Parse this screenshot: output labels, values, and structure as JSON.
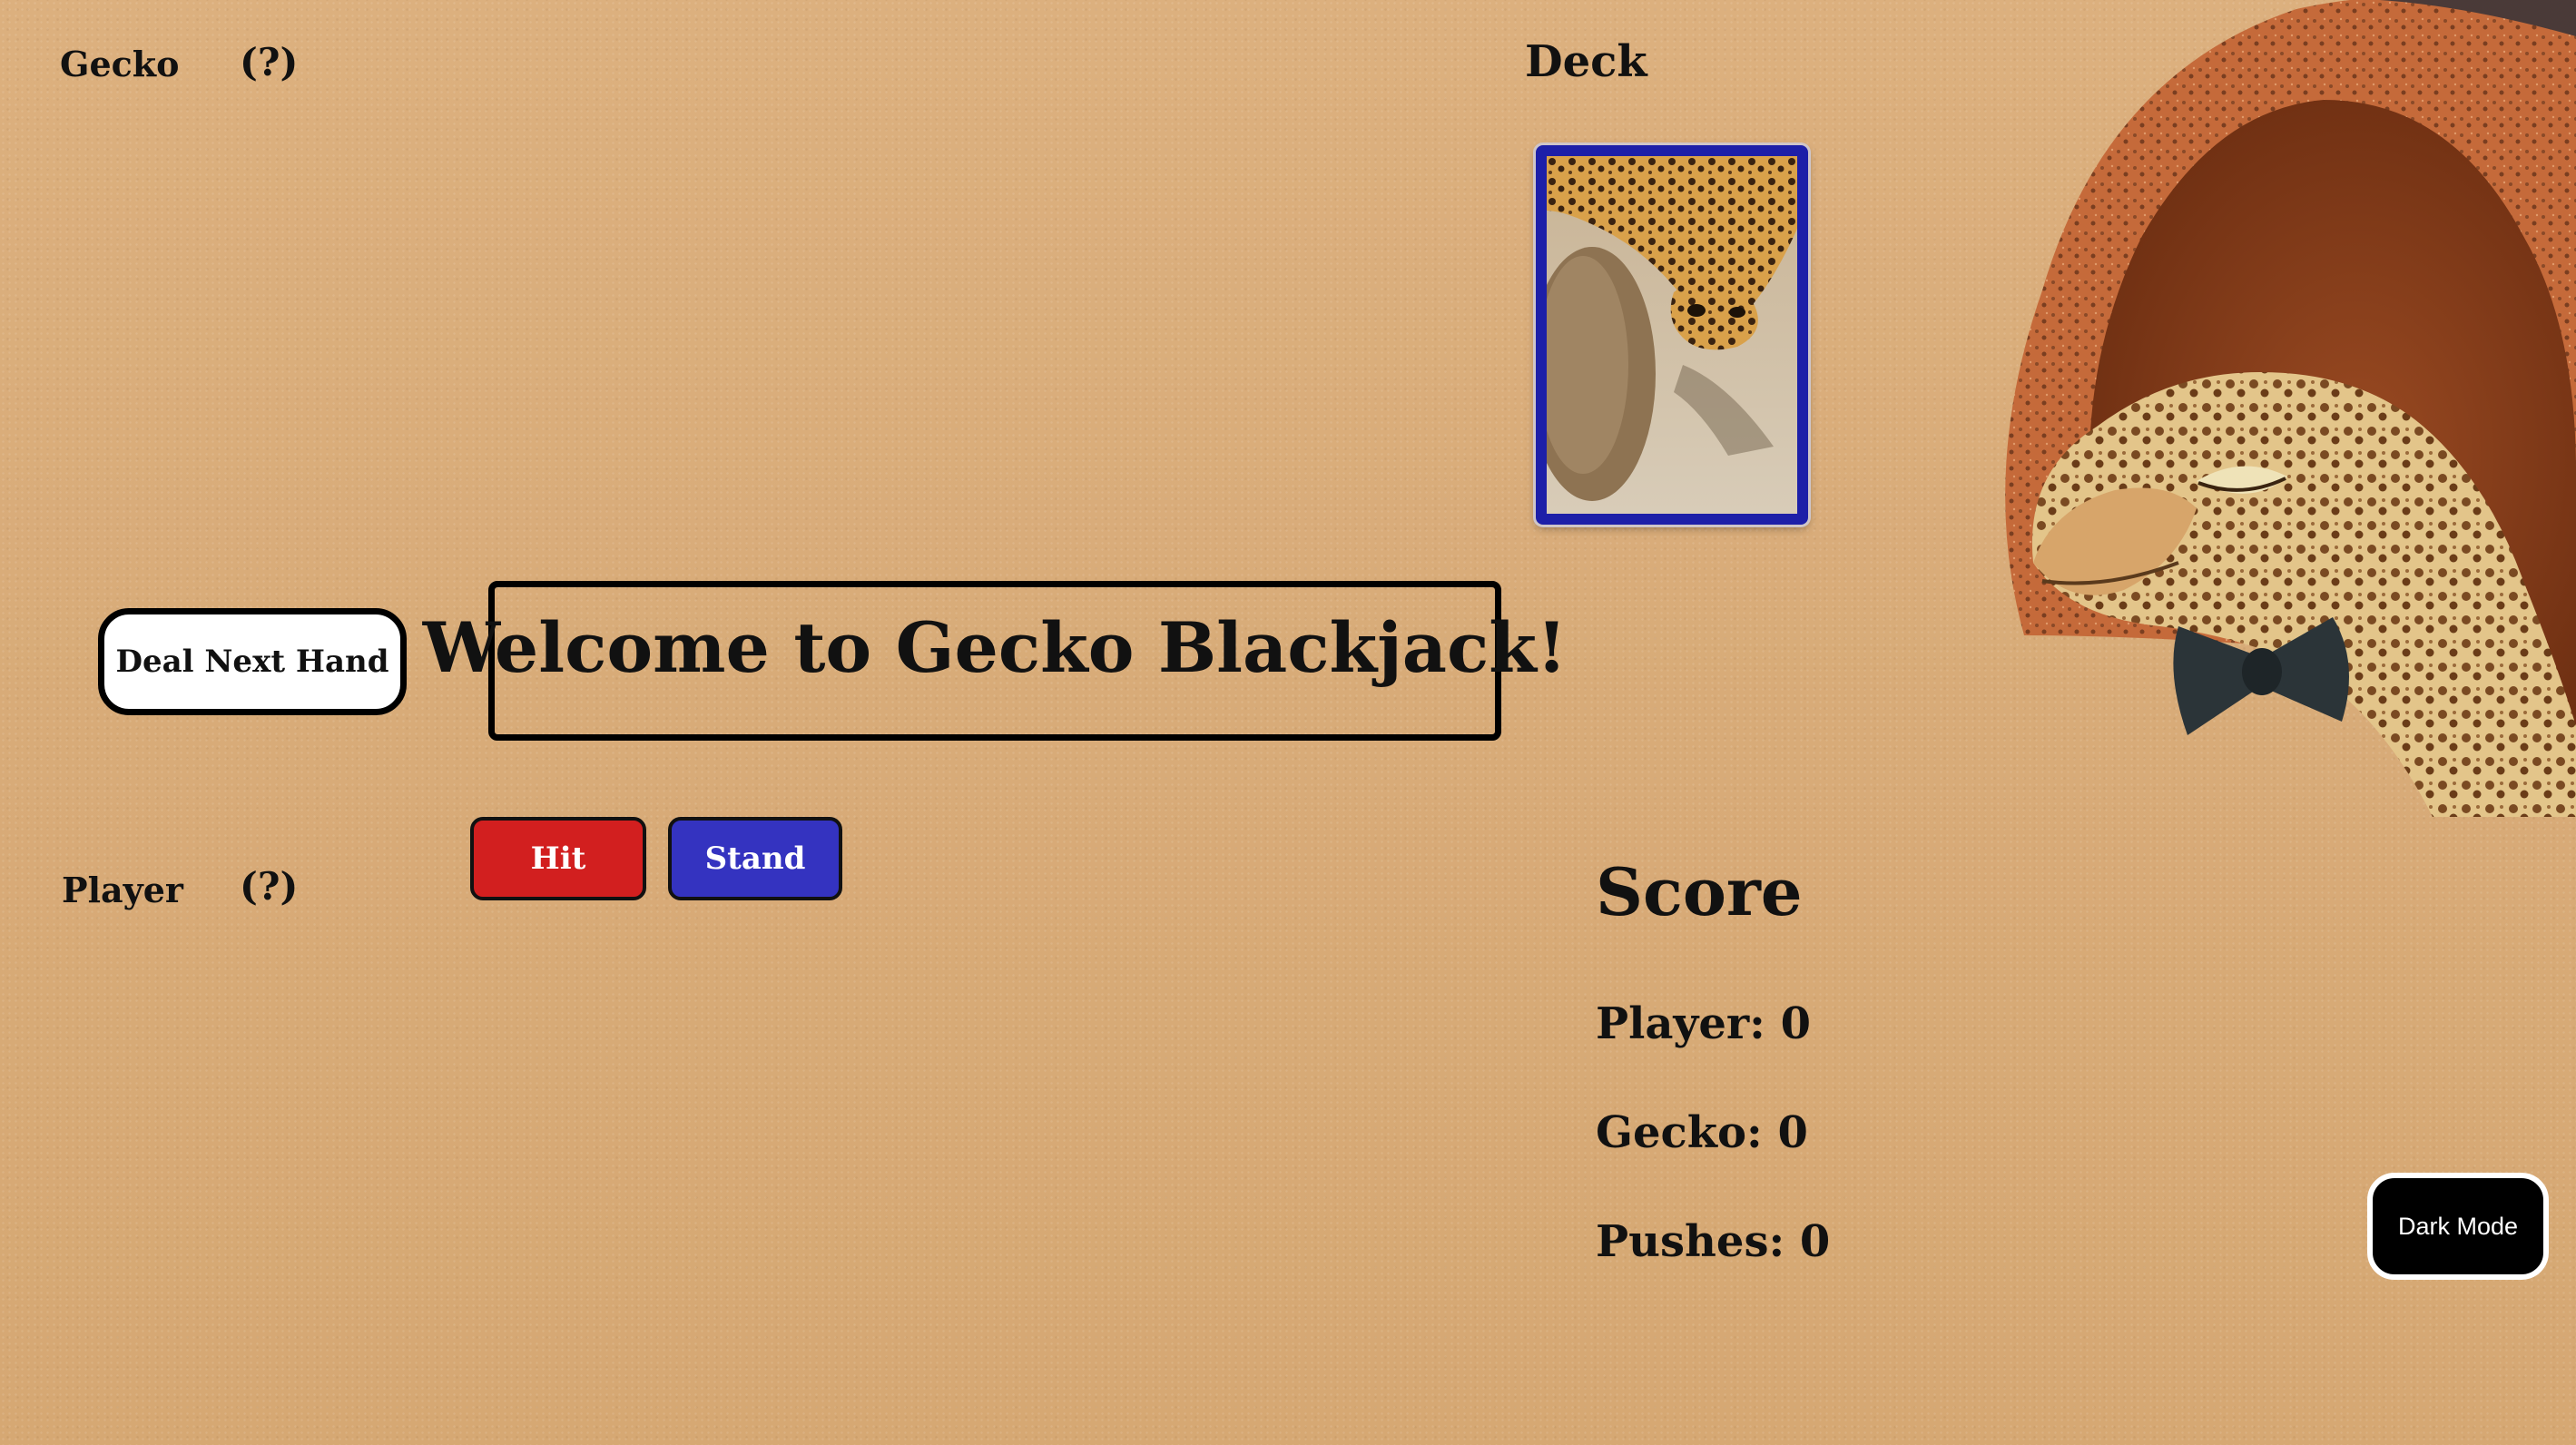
{
  "dealer": {
    "label": "Gecko",
    "total": "(?)"
  },
  "player": {
    "label": "Player",
    "total": "(?)"
  },
  "deck": {
    "label": "Deck",
    "card_back": "gecko-photo-card-back",
    "border_color": "#1d1fa8"
  },
  "controls": {
    "deal_label": "Deal Next Hand",
    "hit_label": "Hit",
    "stand_label": "Stand",
    "dark_mode_label": "Dark Mode"
  },
  "message": {
    "text": "Welcome to Gecko Blackjack!"
  },
  "score": {
    "heading": "Score",
    "player": "Player: 0",
    "gecko": "Gecko: 0",
    "pushes": "Pushes: 0"
  },
  "colors": {
    "background": "#dcb07c",
    "hit": "#d21f1f",
    "stand": "#3433c0",
    "deck_border": "#1d1fa8"
  }
}
